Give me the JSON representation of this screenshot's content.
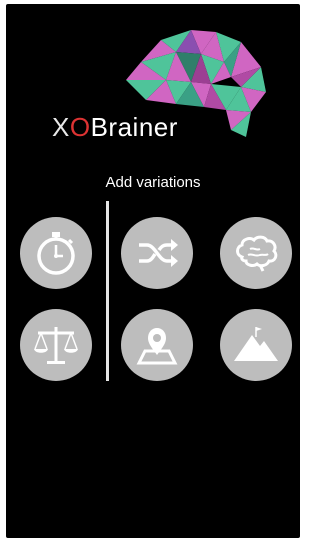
{
  "app": {
    "brand_prefix_x": "X",
    "brand_prefix_o": "O",
    "brand_suffix": "Brainer"
  },
  "screen": {
    "heading": "Add variations"
  },
  "tiles": [
    {
      "icon": "stopwatch-icon"
    },
    {
      "icon": "shuffle-icon"
    },
    {
      "icon": "brain-outline-icon"
    },
    {
      "icon": "balance-scale-icon"
    },
    {
      "icon": "map-pin-icon"
    },
    {
      "icon": "mountain-icon"
    }
  ],
  "colors": {
    "background": "#000000",
    "tile": "#bdbdbd",
    "icon": "#ffffff",
    "brand_o": "#dd3333",
    "brain_pink": "#d066c2",
    "brain_green": "#4fc49a"
  }
}
